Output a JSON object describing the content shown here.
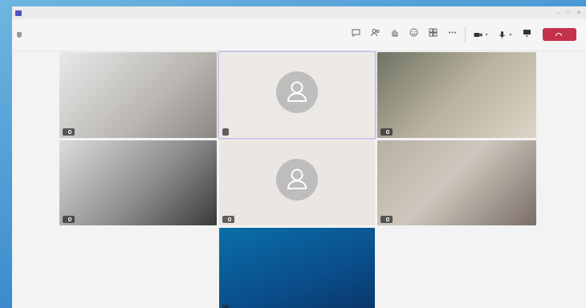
{
  "window": {
    "title": "",
    "controls": [
      "–",
      "□",
      "✕"
    ]
  },
  "toolbar": {
    "meeting_time": "",
    "controls": [
      {
        "icon": "chat-icon",
        "label": ""
      },
      {
        "icon": "people-icon",
        "label": ""
      },
      {
        "icon": "raise-hand-icon",
        "label": ""
      },
      {
        "icon": "react-icon",
        "label": ""
      },
      {
        "icon": "view-icon",
        "label": ""
      },
      {
        "icon": "more-icon",
        "label": ""
      }
    ],
    "camera_label": "",
    "mic_label": "",
    "share_label": "",
    "leave_label": "",
    "leave_color": "#c4314b"
  },
  "participants": [
    {
      "name": ""
    },
    {
      "name": ""
    },
    {
      "name": ""
    },
    {
      "name": ""
    },
    {
      "name": ""
    },
    {
      "name": ""
    },
    {
      "name": ""
    }
  ]
}
